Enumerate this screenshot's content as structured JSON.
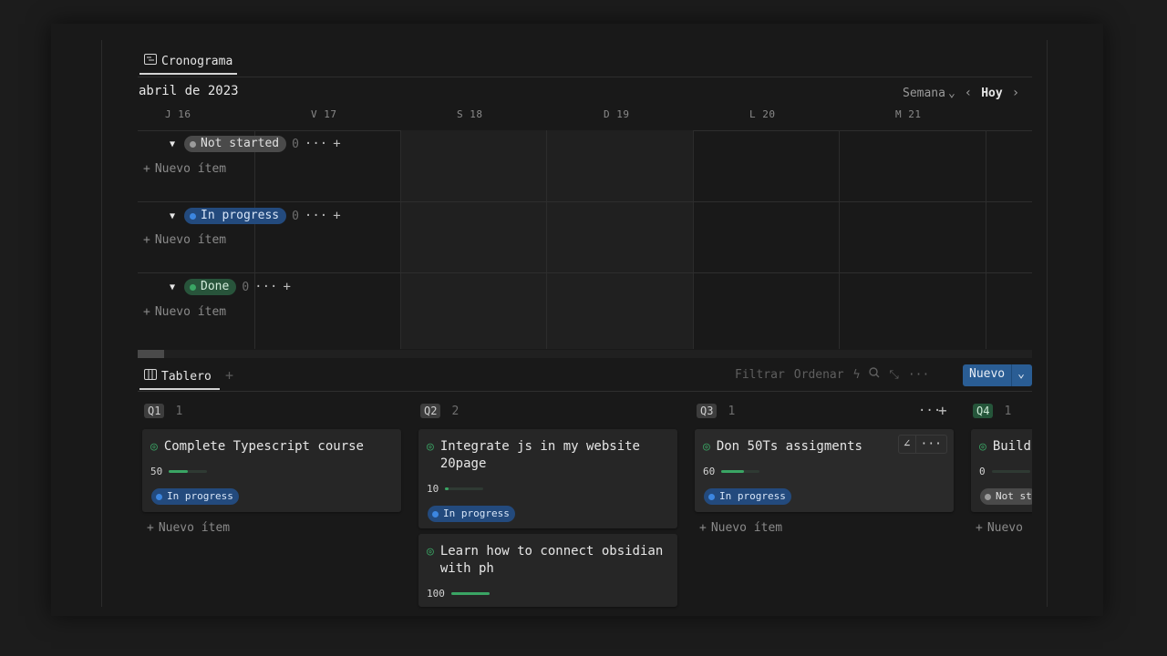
{
  "timeline": {
    "tab_label": "Cronograma",
    "month": "abril de 2023",
    "week_label": "Semana",
    "today_label": "Hoy",
    "days": [
      {
        "label": "J 16"
      },
      {
        "label": "V 17"
      },
      {
        "label": "S 18"
      },
      {
        "label": "D 19"
      },
      {
        "label": "L 20"
      },
      {
        "label": "M 21"
      }
    ],
    "groups": [
      {
        "status": "Not started",
        "count": "0",
        "new_item": "Nuevo ítem"
      },
      {
        "status": "In progress",
        "count": "0",
        "new_item": "Nuevo ítem"
      },
      {
        "status": "Done",
        "count": "0",
        "new_item": "Nuevo ítem"
      }
    ]
  },
  "board": {
    "tab_label": "Tablero",
    "toolbar": {
      "filter": "Filtrar",
      "sort": "Ordenar",
      "new": "Nuevo"
    },
    "columns": [
      {
        "tag": "Q1",
        "count": "1",
        "new_item": "Nuevo ítem",
        "cards": [
          {
            "title": "Complete Typescript course",
            "progress": "50",
            "progress_value": 50,
            "status": "In progress"
          }
        ]
      },
      {
        "tag": "Q2",
        "count": "2",
        "cards": [
          {
            "title": "Integrate js in my website 20page",
            "progress": "10",
            "progress_value": 10,
            "status": "In progress"
          },
          {
            "title": "Learn how to connect obsidian with ph",
            "progress": "100",
            "progress_value": 100
          }
        ]
      },
      {
        "tag": "Q3",
        "count": "1",
        "new_item": "Nuevo ítem",
        "cards": [
          {
            "title": "Don 50Ts assigments",
            "progress": "60",
            "progress_value": 60,
            "status": "In progress"
          }
        ]
      },
      {
        "tag": "Q4",
        "count": "1",
        "new_item": "Nuevo",
        "cards": [
          {
            "title": "Build",
            "progress": "0",
            "progress_value": 0,
            "status": "Not st"
          }
        ]
      }
    ]
  },
  "colors": {
    "accent": "#2a5d94",
    "progress": "#3aa564",
    "in_progress": "#234a7d",
    "done": "#28543b"
  }
}
